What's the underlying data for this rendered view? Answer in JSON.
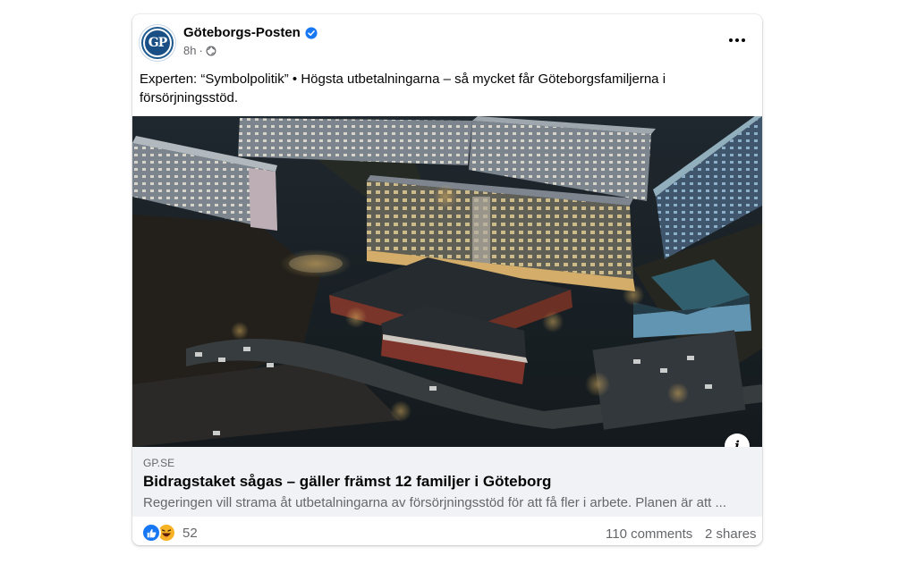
{
  "post": {
    "page_name": "Göteborgs-Posten",
    "avatar_text": "GP",
    "time": "8h",
    "separator": "·",
    "caption": "Experten: “Symbolpolitik” • Högsta utbetalningarna – så mycket får Göteborgsfamiljerna i försörjningsstöd."
  },
  "link": {
    "domain": "GP.SE",
    "title": "Bidragstaket sågas – gäller främst 12 familjer i Göteborg",
    "description": "Regeringen vill strama åt utbetalningarna av försörjningsstöd för att få fler i arbete. Planen är att ..."
  },
  "engagement": {
    "reaction_count": "52",
    "comments": "110 comments",
    "shares": "2 shares"
  },
  "icons": {
    "verified": "verified-badge-icon",
    "audience": "globe-icon",
    "menu": "more-options-icon",
    "info": "info-icon",
    "reaction_1": "like-reaction-icon",
    "reaction_2": "haha-reaction-icon"
  },
  "colors": {
    "brand_blue": "#1877f2",
    "gp_blue": "#1a4f86",
    "link_background": "#f0f2f5",
    "secondary_text": "#65676b"
  }
}
